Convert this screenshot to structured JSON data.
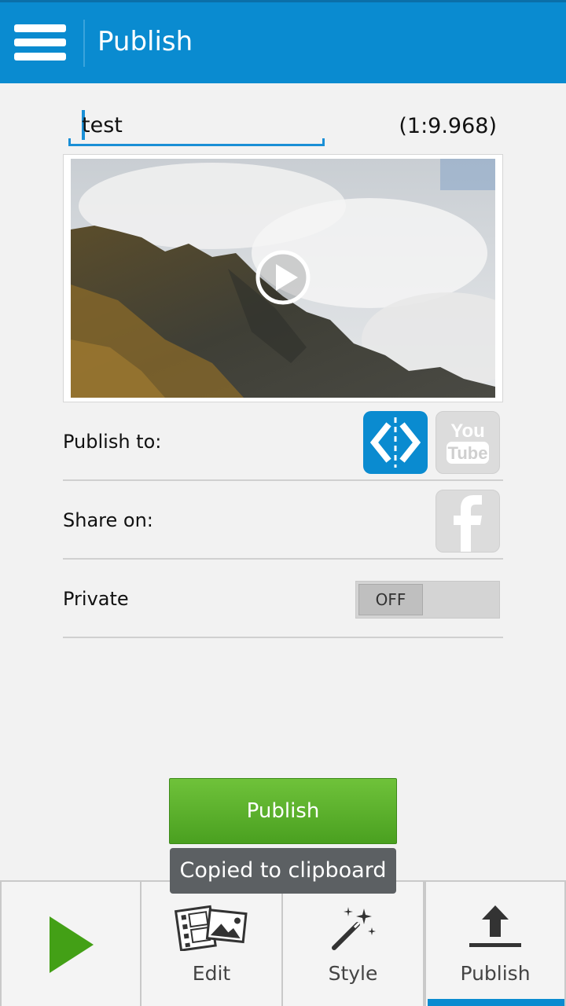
{
  "app_bar": {
    "title": "Publish",
    "menu_icon": "hamburger-menu-icon"
  },
  "video": {
    "title_value": "test",
    "duration": "(1:9.968)",
    "play_icon": "play-circle-icon"
  },
  "rows": {
    "publish_to_label": "Publish to:",
    "share_on_label": "Share on:",
    "private_label": "Private",
    "private_toggle": "OFF"
  },
  "services": {
    "vimeo_icon": "wevideo-logo-icon",
    "youtube_icon": "youtube-icon",
    "youtube_text_1": "You",
    "youtube_text_2": "Tube",
    "facebook_icon": "facebook-icon"
  },
  "actions": {
    "publish_button": "Publish"
  },
  "toast": {
    "message": "Copied to clipboard"
  },
  "bottom_nav": {
    "tabs": [
      {
        "label": "",
        "icon": "play-icon"
      },
      {
        "label": "Edit",
        "icon": "film-photo-icon"
      },
      {
        "label": "Style",
        "icon": "magic-wand-icon"
      },
      {
        "label": "Publish",
        "icon": "upload-icon"
      }
    ],
    "active": "Publish"
  },
  "colors": {
    "primary": "#0a8bd0",
    "publish_green": "#5ab02c",
    "toast_bg": "#5c6063"
  }
}
